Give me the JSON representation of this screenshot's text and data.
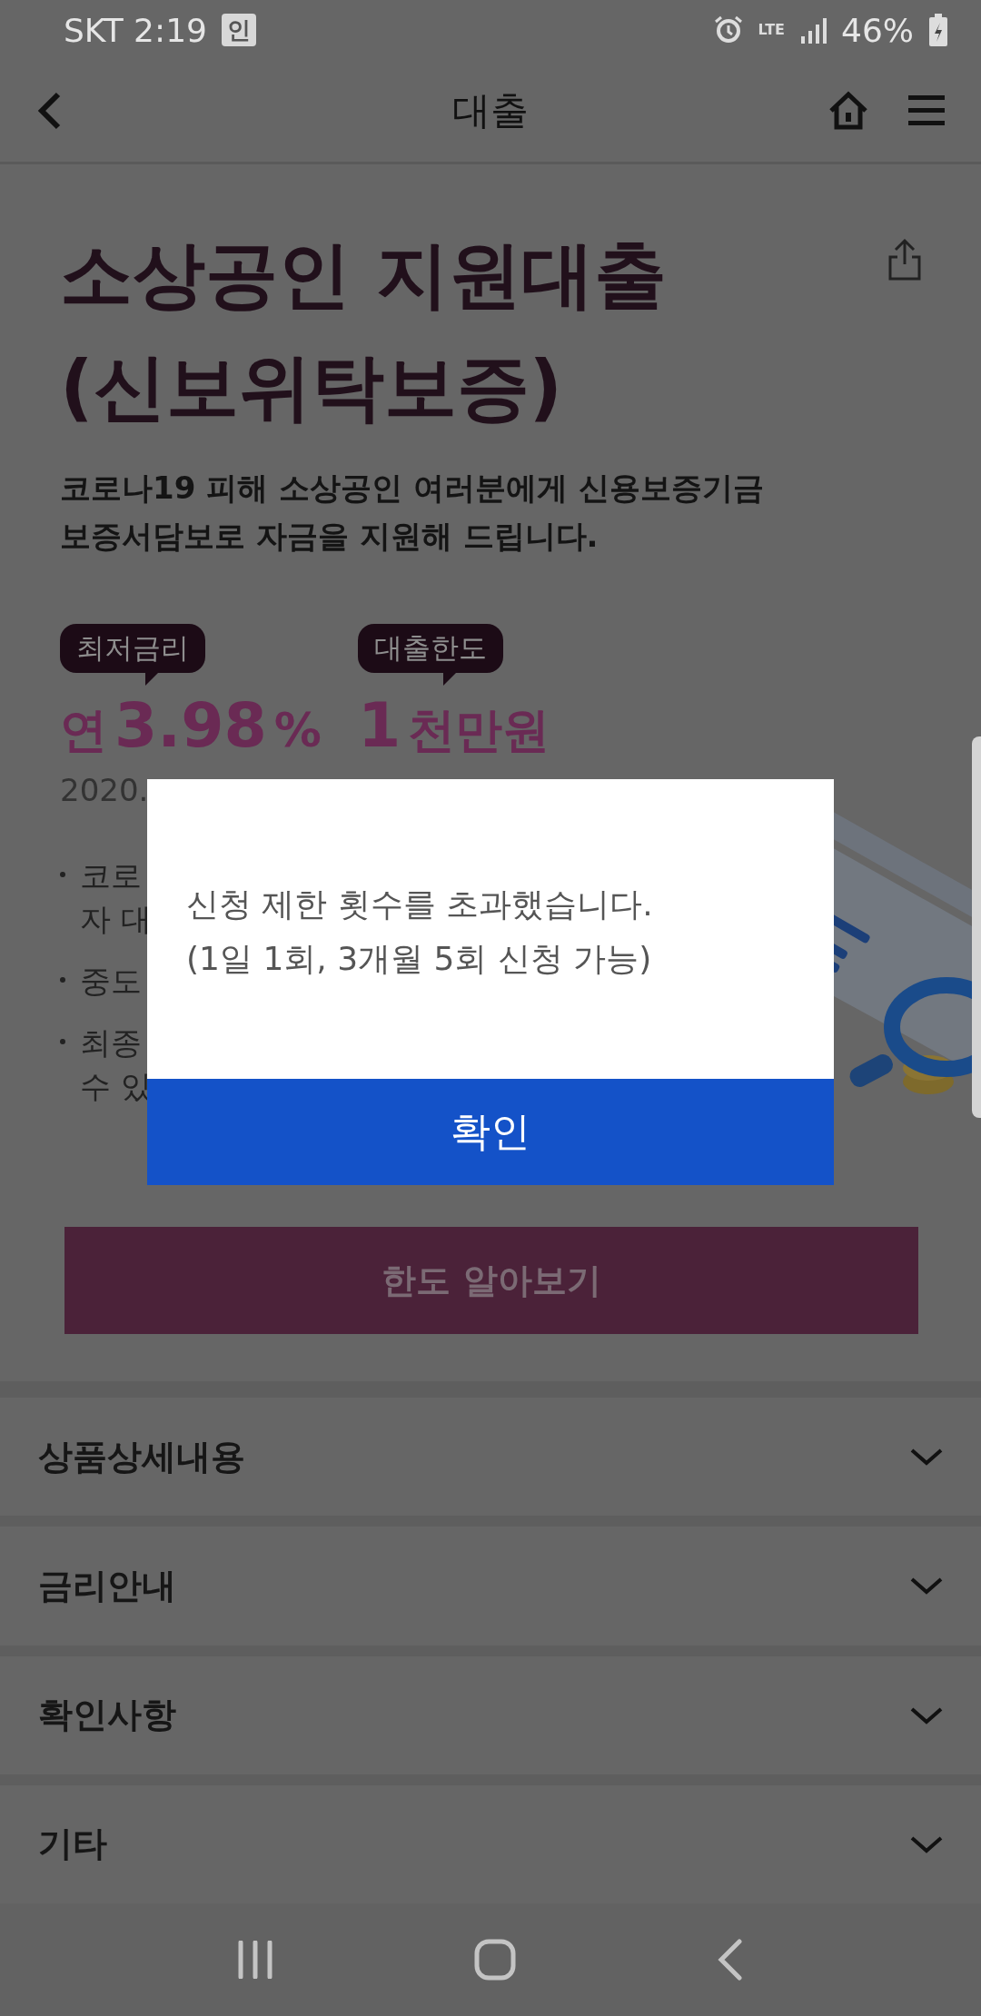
{
  "status_bar": {
    "carrier_time": "SKT 2:19",
    "notification_badge": "인",
    "network": "LTE",
    "battery": "46%"
  },
  "header": {
    "title": "대출"
  },
  "product": {
    "title_lines": [
      "소상공인 지원대출",
      "(신보위탁보증)"
    ],
    "description_lines": [
      "코로나19 피해 소상공인 여러분에게 신용보증기금",
      "보증서담보로 자금을 지원해 드립니다."
    ],
    "stats": [
      {
        "tag": "최저금리",
        "prefix": "연",
        "value": "3.98",
        "unit": "%"
      },
      {
        "tag": "대출한도",
        "value": "1",
        "unit": "천만원"
      }
    ],
    "period": "2020.",
    "notes": [
      {
        "lines": [
          "코로",
          "자 대"
        ]
      },
      {
        "lines": [
          "중도"
        ]
      },
      {
        "lines": [
          "최종",
          "수 있"
        ]
      }
    ],
    "primary_button": "한도 알아보기"
  },
  "sections": [
    {
      "label": "상품상세내용",
      "expanded": false
    },
    {
      "label": "금리안내",
      "expanded": false
    },
    {
      "label": "확인사항",
      "expanded": false
    },
    {
      "label": "기타",
      "expanded": false
    }
  ],
  "dialog": {
    "message_lines": [
      "신청 제한 횟수를 초과했습니다.",
      "(1일 1회, 3개월 5회 신청 가능)"
    ],
    "confirm": "확인"
  }
}
